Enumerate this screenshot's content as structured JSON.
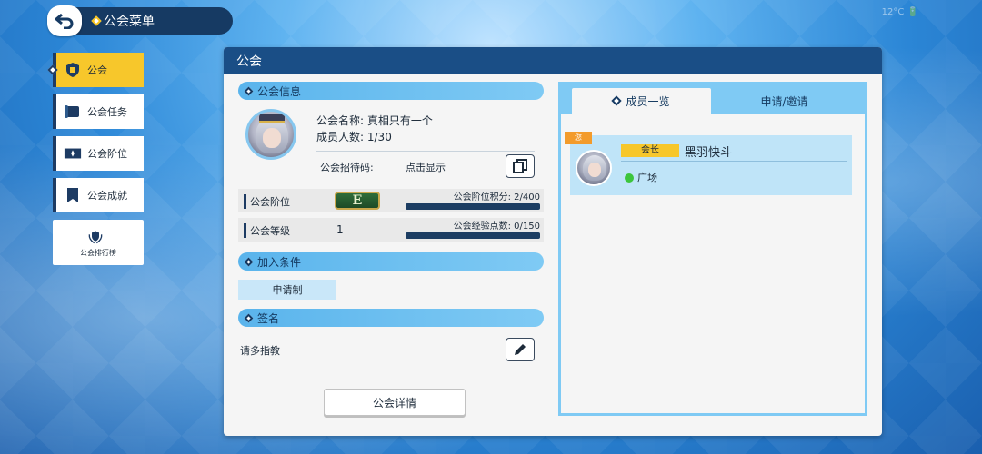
{
  "topbar": {
    "title": "公会菜单",
    "clock": "12°C 🔋"
  },
  "sidebar": {
    "items": [
      {
        "label": "公会",
        "icon": "shield-icon",
        "active": true
      },
      {
        "label": "公会任务",
        "icon": "scroll-icon"
      },
      {
        "label": "公会阶位",
        "icon": "ticket-icon"
      },
      {
        "label": "公会成就",
        "icon": "banner-icon"
      },
      {
        "label": "公会排行榜",
        "icon": "laurel-shield-icon"
      }
    ]
  },
  "panel": {
    "title": "公会"
  },
  "guild_info": {
    "section_title": "公会信息",
    "name_label": "公会名称:",
    "name_value": "真相只有一个",
    "members_label": "成员人数:",
    "members_value": "1/30",
    "code_label": "公会招待码:",
    "code_value": "点击显示"
  },
  "rank": {
    "label": "公会阶位",
    "badge": "E",
    "points_label": "公会阶位积分:",
    "points_value": "2/400",
    "progress": 0.005
  },
  "level": {
    "label": "公会等级",
    "value": "1",
    "exp_label": "公会经验点数:",
    "exp_value": "0/150",
    "progress": 0
  },
  "join": {
    "section_title": "加入条件",
    "mode": "申请制"
  },
  "signature": {
    "section_title": "签名",
    "text": "请多指教"
  },
  "detail_button": "公会详情",
  "members": {
    "tab_list": "成员一览",
    "tab_apply": "申请/邀请",
    "list": [
      {
        "you_tag": "您",
        "role": "会长",
        "name": "黑羽快斗",
        "location": "广场",
        "online": true
      }
    ]
  },
  "colors": {
    "accent": "#f7c72b",
    "header": "#1a4e86",
    "section": "#5ab4ec",
    "online": "#3cc53c"
  }
}
